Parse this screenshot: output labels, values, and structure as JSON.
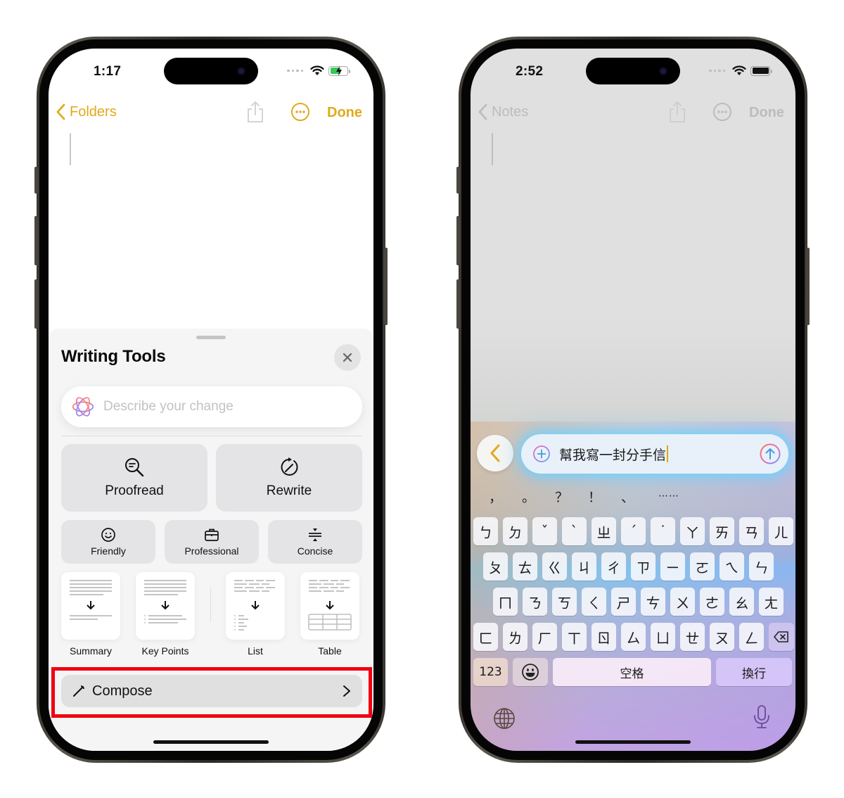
{
  "left_phone": {
    "status": {
      "time": "1:17",
      "battery_color": "#34c759",
      "charging": true
    },
    "nav": {
      "back_label": "Folders",
      "done_label": "Done",
      "accent": "#e3a91b",
      "share_icon": "share-icon",
      "more_icon": "ellipsis-circle-icon"
    },
    "sheet": {
      "title": "Writing Tools",
      "describe_placeholder": "Describe your change",
      "primary_actions": [
        {
          "label": "Proofread",
          "icon": "magnifier-text-icon"
        },
        {
          "label": "Rewrite",
          "icon": "rewrite-icon"
        }
      ],
      "tone_actions": [
        {
          "label": "Friendly",
          "icon": "smiley-icon"
        },
        {
          "label": "Professional",
          "icon": "briefcase-icon"
        },
        {
          "label": "Concise",
          "icon": "compress-icon"
        }
      ],
      "format_actions": [
        {
          "label": "Summary",
          "icon": "summary-doc-icon"
        },
        {
          "label": "Key Points",
          "icon": "key-points-doc-icon"
        },
        {
          "label": "List",
          "icon": "list-doc-icon"
        },
        {
          "label": "Table",
          "icon": "table-doc-icon"
        }
      ],
      "compose": {
        "label": "Compose",
        "icon": "pencil-icon"
      },
      "highlight_color": "#f00010"
    }
  },
  "right_phone": {
    "status": {
      "time": "2:52"
    },
    "nav": {
      "back_label": "Notes",
      "done_label": "Done"
    },
    "prompt": {
      "text": "幫我寫一封分手信"
    },
    "punctuation": [
      "，",
      "。",
      "？",
      "！",
      "、",
      "⋯⋯"
    ],
    "keyboard": {
      "row1": [
        "ㄅ",
        "ㄉ",
        "ˇ",
        "ˋ",
        "ㄓ",
        "ˊ",
        "˙",
        "ㄚ",
        "ㄞ",
        "ㄢ",
        "ㄦ"
      ],
      "row2": [
        "ㄆ",
        "ㄊ",
        "ㄍ",
        "ㄐ",
        "ㄔ",
        "ㄗ",
        "ㄧ",
        "ㄛ",
        "ㄟ",
        "ㄣ"
      ],
      "row3": [
        "ㄇ",
        "ㄋ",
        "ㄎ",
        "ㄑ",
        "ㄕ",
        "ㄘ",
        "ㄨ",
        "ㄜ",
        "ㄠ",
        "ㄤ"
      ],
      "row4": [
        "ㄈ",
        "ㄌ",
        "ㄏ",
        "ㄒ",
        "ㄖ",
        "ㄙ",
        "ㄩ",
        "ㄝ",
        "ㄡ",
        "ㄥ"
      ],
      "numbers_label": "123",
      "space_label": "空格",
      "return_label": "換行"
    }
  }
}
